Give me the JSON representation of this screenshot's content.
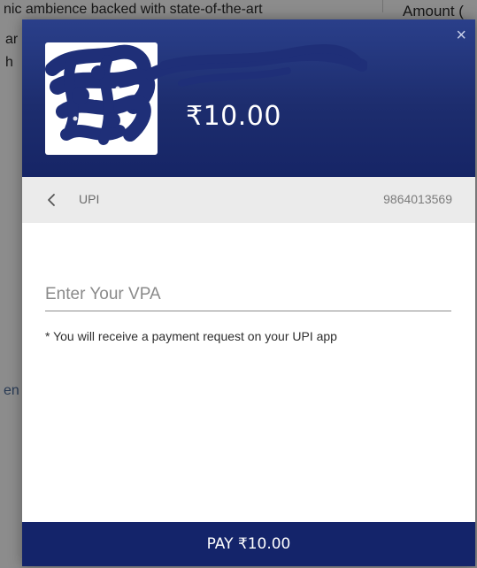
{
  "background_page": {
    "line1": "nic ambience backed with state-of-the-art",
    "amount_label": "Amount (",
    "frag_ar": "ar",
    "frag_h": "h",
    "frag_en": "en"
  },
  "modal": {
    "close_glyph": "×",
    "merchant": {
      "logo_icon": "merchant-logo-redacted"
    },
    "amount": "₹10.00",
    "method_bar": {
      "back_glyph": "‹",
      "label": "UPI",
      "phone": "9864013569"
    },
    "form": {
      "vpa_placeholder": "Enter Your VPA",
      "vpa_value": "",
      "note": "* You will receive a payment request on your UPI app"
    },
    "pay_button_label": "PAY ₹10.00"
  },
  "colors": {
    "header_gradient_top": "#2a3f8a",
    "header_gradient_bottom": "#162566",
    "pay_button": "#14246a",
    "redaction_scribble": "#1f2f78"
  }
}
